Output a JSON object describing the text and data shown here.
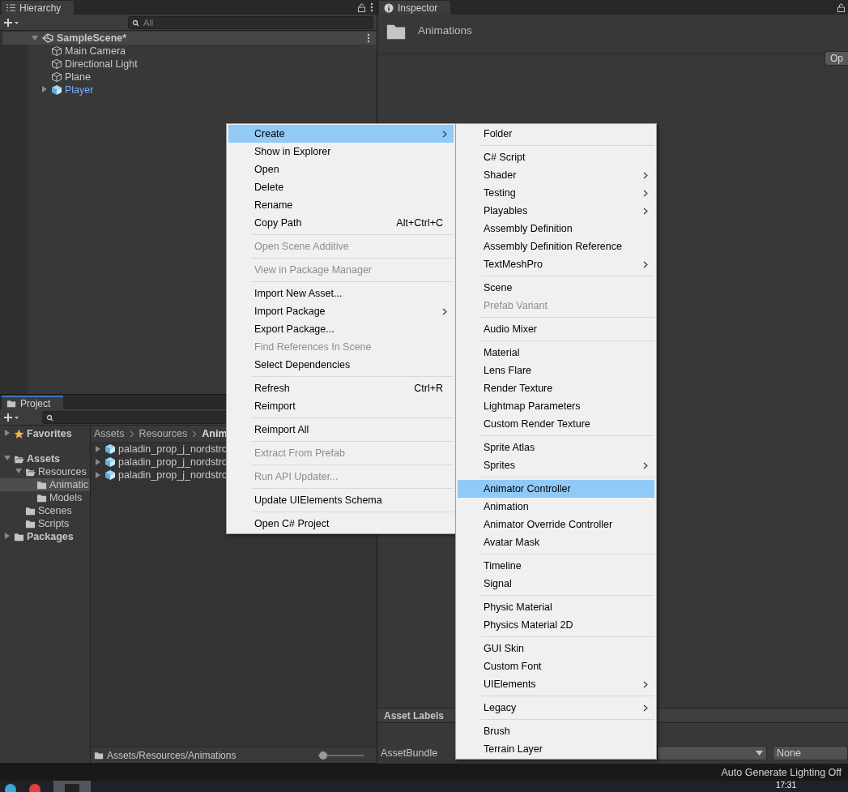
{
  "hierarchy": {
    "tab": "Hierarchy",
    "search": {
      "placeholder": "All"
    },
    "scene": {
      "label": "SampleScene*",
      "expanded": true,
      "children": [
        {
          "label": "Main Camera",
          "kind": "object"
        },
        {
          "label": "Directional Light",
          "kind": "object"
        },
        {
          "label": "Plane",
          "kind": "object"
        },
        {
          "label": "Player",
          "kind": "prefab",
          "expanded": false
        }
      ]
    }
  },
  "inspector": {
    "tab": "Inspector",
    "title": "Animations",
    "open_button": "Op",
    "labels_header": "Asset Labels",
    "bundle_label": "AssetBundle",
    "bundle_variant": "None"
  },
  "project": {
    "tab": "Project",
    "tree": [
      {
        "label": "Favorites",
        "kind": "favorites",
        "expanded": false,
        "selected": false
      },
      {
        "label": "Assets",
        "kind": "root",
        "expanded": true,
        "selected": false,
        "children": [
          {
            "label": "Resources",
            "kind": "folder",
            "expanded": true,
            "selected": false,
            "children": [
              {
                "label": "Animatic",
                "kind": "folder",
                "selected": true
              },
              {
                "label": "Models",
                "kind": "folder",
                "selected": false
              }
            ]
          },
          {
            "label": "Scenes",
            "kind": "folder",
            "selected": false
          },
          {
            "label": "Scripts",
            "kind": "folder",
            "selected": false
          }
        ]
      },
      {
        "label": "Packages",
        "kind": "root",
        "expanded": false,
        "selected": false
      }
    ],
    "breadcrumb": [
      "Assets",
      "Resources",
      "Anim"
    ],
    "files": [
      "paladin_prop_j_nordstro",
      "paladin_prop_j_nordstro",
      "paladin_prop_j_nordstro"
    ],
    "path": "Assets/Resources/Animations",
    "zoom": {
      "level": 0.1
    }
  },
  "context_menu": {
    "groups": [
      [
        {
          "label": "Create",
          "submenu": true,
          "disabled": false,
          "selected": true
        },
        {
          "label": "Show in Explorer",
          "submenu": false,
          "disabled": false,
          "selected": false
        },
        {
          "label": "Open",
          "submenu": false,
          "disabled": false,
          "selected": false
        },
        {
          "label": "Delete",
          "submenu": false,
          "disabled": false,
          "selected": false
        },
        {
          "label": "Rename",
          "submenu": false,
          "disabled": false,
          "selected": false
        },
        {
          "label": "Copy Path",
          "shortcut": "Alt+Ctrl+C",
          "submenu": false,
          "disabled": false,
          "selected": false
        }
      ],
      [
        {
          "label": "Open Scene Additive",
          "submenu": false,
          "disabled": true,
          "selected": false
        }
      ],
      [
        {
          "label": "View in Package Manager",
          "submenu": false,
          "disabled": true,
          "selected": false
        }
      ],
      [
        {
          "label": "Import New Asset...",
          "submenu": false,
          "disabled": false,
          "selected": false
        },
        {
          "label": "Import Package",
          "submenu": true,
          "disabled": false,
          "selected": false
        },
        {
          "label": "Export Package...",
          "submenu": false,
          "disabled": false,
          "selected": false
        },
        {
          "label": "Find References In Scene",
          "submenu": false,
          "disabled": true,
          "selected": false
        },
        {
          "label": "Select Dependencies",
          "submenu": false,
          "disabled": false,
          "selected": false
        }
      ],
      [
        {
          "label": "Refresh",
          "shortcut": "Ctrl+R",
          "submenu": false,
          "disabled": false,
          "selected": false
        },
        {
          "label": "Reimport",
          "submenu": false,
          "disabled": false,
          "selected": false
        }
      ],
      [
        {
          "label": "Reimport All",
          "submenu": false,
          "disabled": false,
          "selected": false
        }
      ],
      [
        {
          "label": "Extract From Prefab",
          "submenu": false,
          "disabled": true,
          "selected": false
        }
      ],
      [
        {
          "label": "Run API Updater...",
          "submenu": false,
          "disabled": true,
          "selected": false
        }
      ],
      [
        {
          "label": "Update UIElements Schema",
          "submenu": false,
          "disabled": false,
          "selected": false
        }
      ],
      [
        {
          "label": "Open C# Project",
          "submenu": false,
          "disabled": false,
          "selected": false
        }
      ]
    ]
  },
  "create_submenu": {
    "groups": [
      [
        {
          "label": "Folder",
          "submenu": false,
          "disabled": false,
          "selected": false
        }
      ],
      [
        {
          "label": "C# Script",
          "submenu": false,
          "disabled": false,
          "selected": false
        },
        {
          "label": "Shader",
          "submenu": true,
          "disabled": false,
          "selected": false
        },
        {
          "label": "Testing",
          "submenu": true,
          "disabled": false,
          "selected": false
        },
        {
          "label": "Playables",
          "submenu": true,
          "disabled": false,
          "selected": false
        },
        {
          "label": "Assembly Definition",
          "submenu": false,
          "disabled": false,
          "selected": false
        },
        {
          "label": "Assembly Definition Reference",
          "submenu": false,
          "disabled": false,
          "selected": false
        },
        {
          "label": "TextMeshPro",
          "submenu": true,
          "disabled": false,
          "selected": false
        }
      ],
      [
        {
          "label": "Scene",
          "submenu": false,
          "disabled": false,
          "selected": false
        },
        {
          "label": "Prefab Variant",
          "submenu": false,
          "disabled": true,
          "selected": false
        }
      ],
      [
        {
          "label": "Audio Mixer",
          "submenu": false,
          "disabled": false,
          "selected": false
        }
      ],
      [
        {
          "label": "Material",
          "submenu": false,
          "disabled": false,
          "selected": false
        },
        {
          "label": "Lens Flare",
          "submenu": false,
          "disabled": false,
          "selected": false
        },
        {
          "label": "Render Texture",
          "submenu": false,
          "disabled": false,
          "selected": false
        },
        {
          "label": "Lightmap Parameters",
          "submenu": false,
          "disabled": false,
          "selected": false
        },
        {
          "label": "Custom Render Texture",
          "submenu": false,
          "disabled": false,
          "selected": false
        }
      ],
      [
        {
          "label": "Sprite Atlas",
          "submenu": false,
          "disabled": false,
          "selected": false
        },
        {
          "label": "Sprites",
          "submenu": true,
          "disabled": false,
          "selected": false
        }
      ],
      [
        {
          "label": "Animator Controller",
          "submenu": false,
          "disabled": false,
          "selected": true
        },
        {
          "label": "Animation",
          "submenu": false,
          "disabled": false,
          "selected": false
        },
        {
          "label": "Animator Override Controller",
          "submenu": false,
          "disabled": false,
          "selected": false
        },
        {
          "label": "Avatar Mask",
          "submenu": false,
          "disabled": false,
          "selected": false
        }
      ],
      [
        {
          "label": "Timeline",
          "submenu": false,
          "disabled": false,
          "selected": false
        },
        {
          "label": "Signal",
          "submenu": false,
          "disabled": false,
          "selected": false
        }
      ],
      [
        {
          "label": "Physic Material",
          "submenu": false,
          "disabled": false,
          "selected": false
        },
        {
          "label": "Physics Material 2D",
          "submenu": false,
          "disabled": false,
          "selected": false
        }
      ],
      [
        {
          "label": "GUI Skin",
          "submenu": false,
          "disabled": false,
          "selected": false
        },
        {
          "label": "Custom Font",
          "submenu": false,
          "disabled": false,
          "selected": false
        },
        {
          "label": "UIElements",
          "submenu": true,
          "disabled": false,
          "selected": false
        }
      ],
      [
        {
          "label": "Legacy",
          "submenu": true,
          "disabled": false,
          "selected": false
        }
      ],
      [
        {
          "label": "Brush",
          "submenu": false,
          "disabled": false,
          "selected": false
        },
        {
          "label": "Terrain Layer",
          "submenu": false,
          "disabled": false,
          "selected": false
        }
      ]
    ]
  },
  "status_bar": {
    "text": "Auto Generate Lighting Off"
  },
  "taskbar": {
    "clock": "17:31"
  }
}
